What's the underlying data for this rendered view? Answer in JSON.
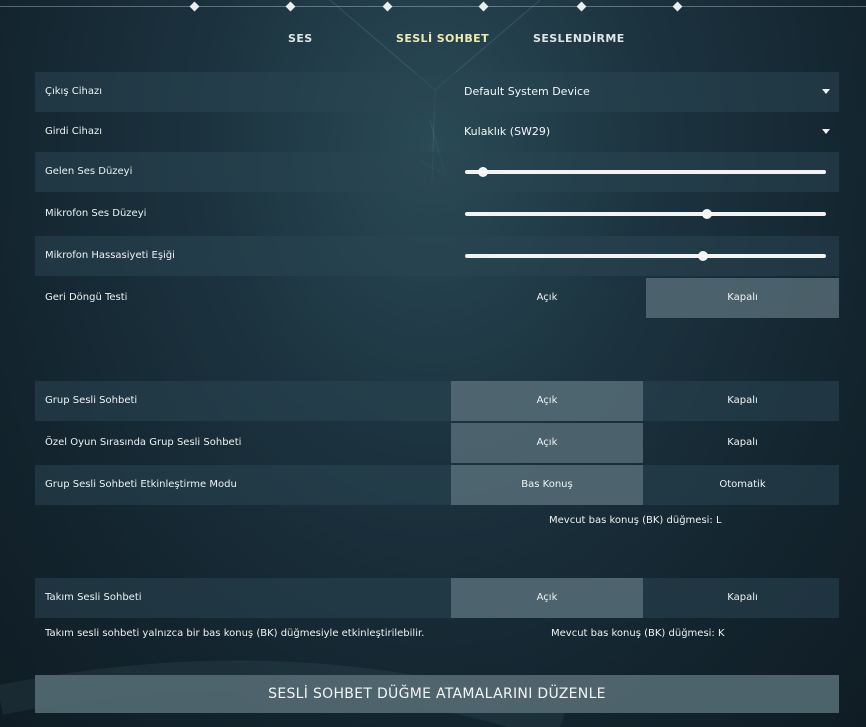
{
  "tabs": [
    {
      "label": "SES"
    },
    {
      "label": "SESLİ SOHBET"
    },
    {
      "label": "SESLENDİRME"
    }
  ],
  "settings": {
    "output_device": {
      "label": "Çıkış Cihazı",
      "value": "Default System Device"
    },
    "input_device": {
      "label": "Girdi Cihazı",
      "value": "Kulaklık (SW29)"
    },
    "incoming_volume": {
      "label": "Gelen Ses Düzeyi",
      "level": 0.05
    },
    "mic_volume": {
      "label": "Mikrofon Ses Düzeyi",
      "level": 0.67
    },
    "mic_sensitivity": {
      "label": "Mikrofon Hassasiyeti Eşiği",
      "level": 0.66
    },
    "loopback_test": {
      "label": "Geri Döngü Testi",
      "option_on": "Açık",
      "option_off": "Kapalı",
      "selected": "off"
    },
    "group_voice": {
      "label": "Grup Sesli Sohbeti",
      "option_on": "Açık",
      "option_off": "Kapalı",
      "selected": "on"
    },
    "custom_group_voice": {
      "label": "Özel Oyun Sırasında Grup Sesli Sohbeti",
      "option_on": "Açık",
      "option_off": "Kapalı",
      "selected": "on"
    },
    "group_activation_mode": {
      "label": "Grup Sesli Sohbeti Etkinleştirme Modu",
      "option_on": "Bas Konuş",
      "option_off": "Otomatik",
      "selected": "on"
    },
    "group_ptt_note": "Mevcut bas konuş (BK) düğmesi: L",
    "team_voice": {
      "label": "Takım Sesli Sohbeti",
      "option_on": "Açık",
      "option_off": "Kapalı",
      "selected": "on"
    },
    "team_note": "Takım sesli sohbeti yalnızca bir bas konuş (BK) düğmesiyle etkinleştirilebilir.",
    "team_ptt_note": "Mevcut bas konuş (BK) düğmesi: K"
  },
  "edit_keybinds_button": "SESLİ SOHBET DÜĞME ATAMALARINI DÜZENLE",
  "colors": {
    "active_tab": "#ecebb0",
    "toggle_selected": "#5c737c",
    "row_background": "#2a4652"
  }
}
